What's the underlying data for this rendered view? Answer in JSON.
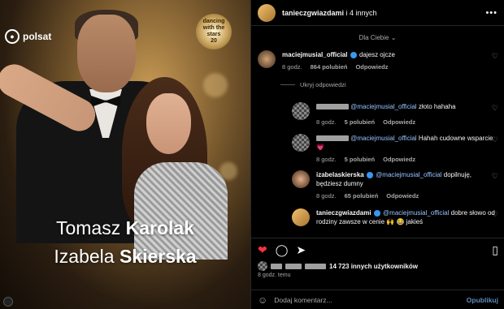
{
  "media": {
    "brand": "polsat",
    "show_logo_lines": [
      "dancing",
      "with the",
      "stars",
      "20"
    ],
    "name1_first": "Tomasz",
    "name1_last": "Karolak",
    "name2_first": "Izabela",
    "name2_last": "Skierska"
  },
  "header": {
    "username": "tanieczgwiazdami",
    "suffix": " i 4 innych",
    "more": "•••"
  },
  "sort_label": "Dla Ciebie ⌄",
  "comments": [
    {
      "user": "maciejmusial_official",
      "text": "dajesz ojcze",
      "time": "8 godz.",
      "likes": "864 polubień",
      "reply": "Odpowiedz"
    },
    {
      "user": "",
      "mention": "@maciejmusial_official",
      "text": "złoto hahaha",
      "time": "8 godz.",
      "likes": "5 polubień",
      "reply": "Odpowiedz"
    },
    {
      "user": "",
      "mention": "@maciejmusial_official",
      "text": "Hahah cudowne wsparcie 💗",
      "time": "8 godz.",
      "likes": "5 polubień",
      "reply": "Odpowiedz"
    },
    {
      "user": "izabelaskierska",
      "mention": "@maciejmusial_official",
      "text": "dopilnuję, będziesz dumny",
      "time": "8 godz.",
      "likes": "65 polubień",
      "reply": "Odpowiedz"
    },
    {
      "user": "tanieczgwiazdami",
      "mention": "@maciejmusial_official",
      "text": "dobre słowo od rodziny zawsze w cenie 🙌 😂 jakieś",
      "time": "",
      "likes": "",
      "reply": ""
    }
  ],
  "hide_replies": "Ukryj odpowiedzi",
  "likes_text": "14 723 innych użytkowników",
  "post_time": "8 godz. temu",
  "add_comment": {
    "placeholder": "Dodaj komentarz...",
    "publish": "Opublikuj"
  },
  "icons": {
    "like": "heart-icon",
    "comment": "comment-icon",
    "share": "share-icon",
    "save": "bookmark-icon",
    "emoji": "smiley-icon"
  }
}
